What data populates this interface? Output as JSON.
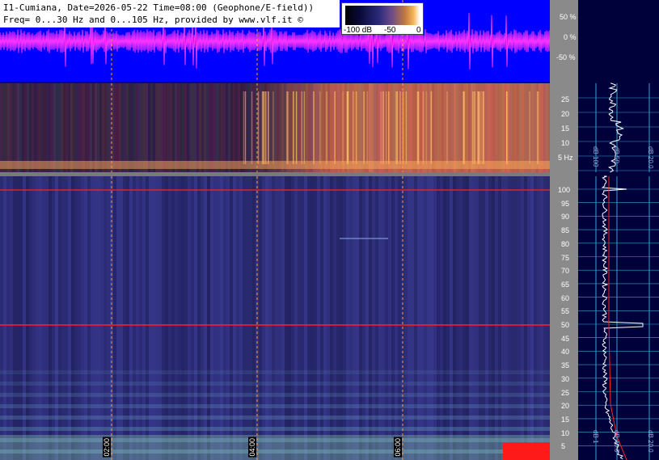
{
  "header": {
    "line1": "I1-Cumiana, Date=2026-05-22 Time=08:00 (Geophone/E-field))",
    "line2": "Freq= 0...30 Hz and 0...105 Hz, provided by www.vlf.it ©"
  },
  "colorbar": {
    "labels": [
      "-100 dB",
      "-50",
      "0"
    ],
    "colors": [
      "#000000",
      "#2a2a7a",
      "#c07840",
      "#ffffff"
    ]
  },
  "waveform_axis": [
    "50 %",
    "0 %",
    "-50 %"
  ],
  "upper_axis": [
    "25",
    "20",
    "15",
    "10",
    "5 Hz"
  ],
  "lower_axis": [
    "100",
    "95",
    "90",
    "85",
    "80",
    "75",
    "70",
    "65",
    "60",
    "55",
    "50",
    "45",
    "40",
    "35",
    "30",
    "25",
    "20",
    "15",
    "10",
    "5"
  ],
  "time_labels": [
    "02:00",
    "04:00",
    "06:00"
  ],
  "side_upper_labels": [
    "dB 100",
    "dB 50",
    "dB 20.0"
  ],
  "side_lower_labels": [
    "dB 1",
    "dB 40.0",
    "dB 20.0"
  ],
  "colors": {
    "waveform_bg": "#0000ff",
    "waveform_trace": "#ff33ff",
    "spectrogram_bg": "#20205e",
    "line_50hz": "#ff2020",
    "side_panel_bg": "#00003a",
    "side_grid": "#3aa0d0",
    "dashed_time": "#ff9a40"
  }
}
